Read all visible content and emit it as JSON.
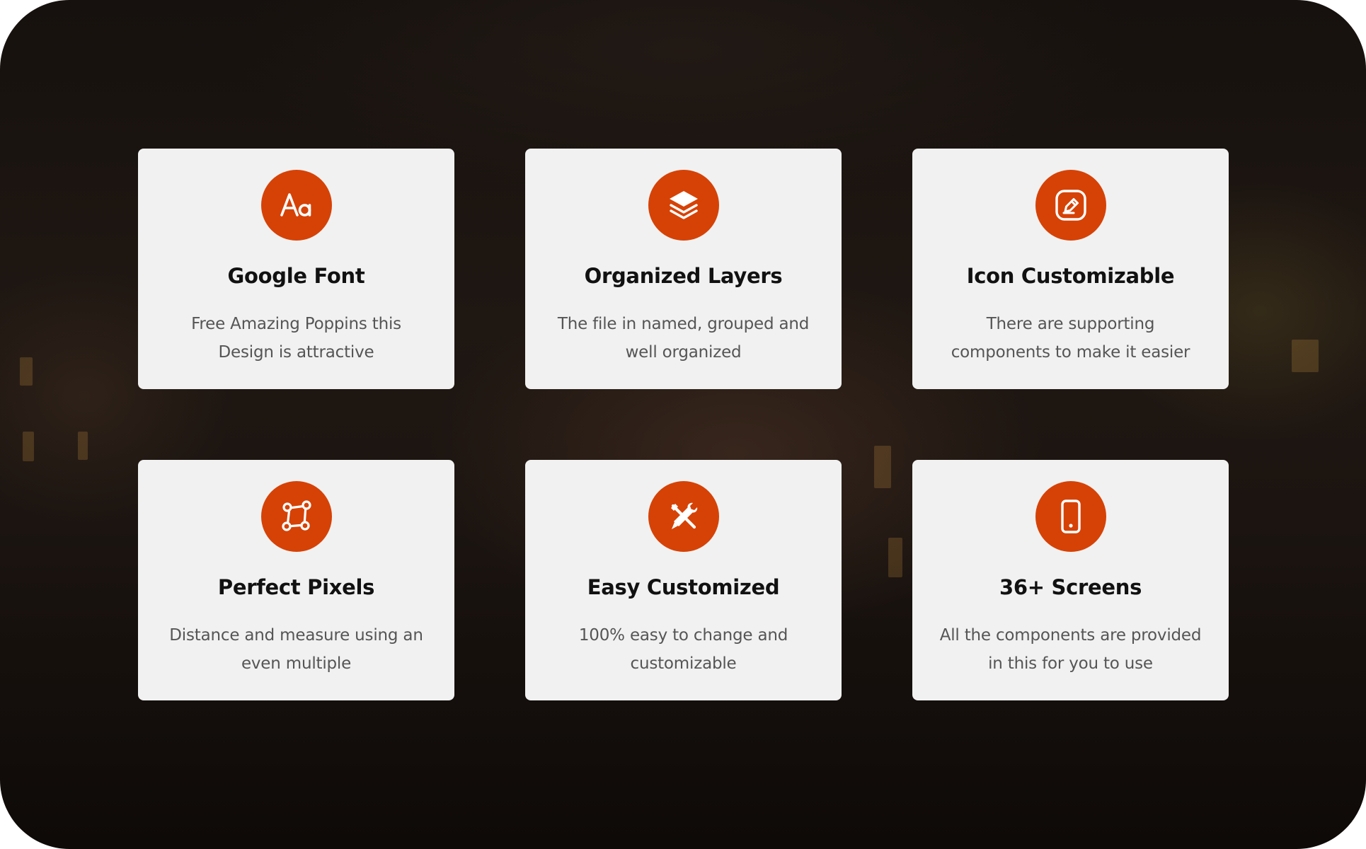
{
  "theme": {
    "accent": "#d64206",
    "card_background": "#f1f1f1",
    "title_color": "#111111",
    "text_color": "#555555"
  },
  "features": [
    {
      "icon": "font-aa-icon",
      "title": "Google Font",
      "description": "Free Amazing Poppins this Design is attractive"
    },
    {
      "icon": "layers-icon",
      "title": "Organized Layers",
      "description": "The file in named, grouped and well organized"
    },
    {
      "icon": "edit-square-icon",
      "title": "Icon Customizable",
      "description": "There are supporting components to make it easier"
    },
    {
      "icon": "vector-shape-icon",
      "title": "Perfect Pixels",
      "description": "Distance and measure using an even multiple"
    },
    {
      "icon": "tools-icon",
      "title": "Easy Customized",
      "description": "100% easy to change and customizable"
    },
    {
      "icon": "mobile-phone-icon",
      "title": "36+ Screens",
      "description": "All the components are provided in this for you to use"
    }
  ]
}
